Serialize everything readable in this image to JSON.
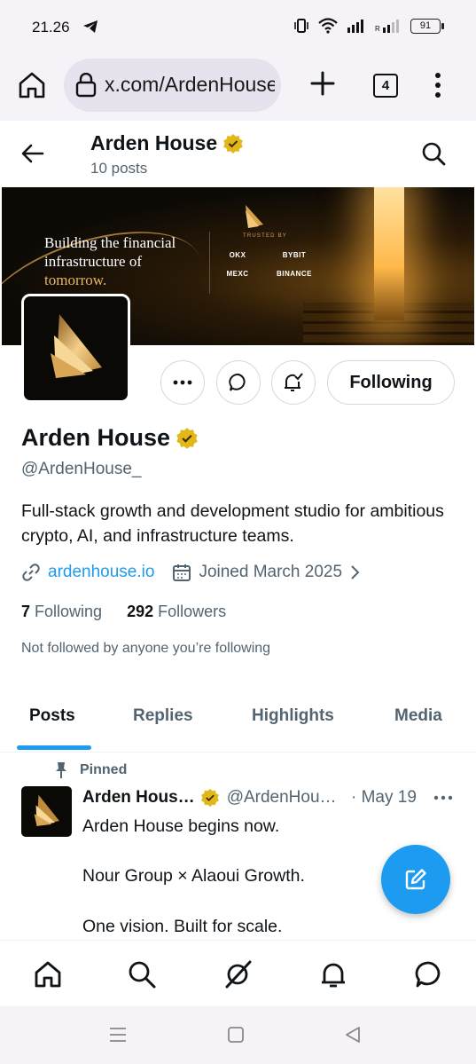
{
  "status_bar": {
    "time": "21.26",
    "battery": "91"
  },
  "browser": {
    "url": "x.com/ArdenHouse_",
    "tab_count": "4"
  },
  "header": {
    "name": "Arden House",
    "posts_count": "10 posts"
  },
  "banner": {
    "headline_line1": "Building the financial",
    "headline_line2": "infrastructure of",
    "headline_line3": "tomorrow.",
    "trusted_by": "TRUSTED BY",
    "partners": [
      "OKX",
      "BYBIT",
      "MEXC",
      "BINANCE"
    ]
  },
  "profile": {
    "follow_label": "Following",
    "display_name": "Arden House",
    "handle": "@ArdenHouse_",
    "bio": "Full-stack growth and development studio for ambitious crypto, AI, and infrastructure teams.",
    "website": "ardenhouse.io",
    "joined": "Joined March 2025",
    "following_count": "7",
    "following_label": "Following",
    "followers_count": "292",
    "followers_label": "Followers",
    "not_followed": "Not followed by anyone you’re following"
  },
  "tabs": [
    "Posts",
    "Replies",
    "Highlights",
    "Media"
  ],
  "post": {
    "pinned_label": "Pinned",
    "name": "Arden Hous…",
    "handle": "@ArdenHou…",
    "date": "· May 19",
    "lines": [
      "Arden House begins now.",
      "Nour Group × Alaoui Growth.",
      "One vision. Built for scale."
    ]
  },
  "colors": {
    "accent": "#1d9bf0",
    "verified": "#e2b719",
    "text": "#0f1419",
    "muted": "#536471"
  }
}
